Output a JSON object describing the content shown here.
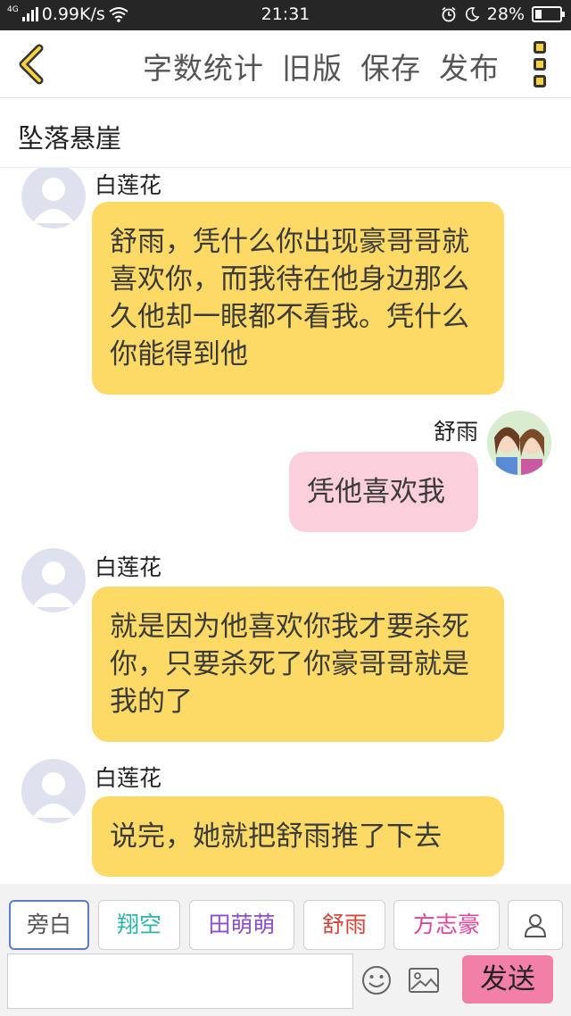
{
  "status_bar": {
    "network_tag": "4G",
    "speed": "0.99K/s",
    "time": "21:31",
    "battery_text": "28%",
    "battery_level": 0.28
  },
  "toolbar": {
    "word_count_label": "字数统计",
    "old_version_label": "旧版",
    "save_label": "保存",
    "publish_label": "发布"
  },
  "story": {
    "title": "坠落悬崖"
  },
  "messages": [
    {
      "speaker": "白莲花",
      "side": "left",
      "text": "舒雨，凭什么你出现豪哥哥就喜欢你，而我待在他身边那么久他却一眼都不看我。凭什么你能得到他"
    },
    {
      "speaker": "舒雨",
      "side": "right",
      "text": "凭他喜欢我"
    },
    {
      "speaker": "白莲花",
      "side": "left",
      "text": "就是因为他喜欢你我才要杀死你，只要杀死了你豪哥哥就是我的了"
    },
    {
      "speaker": "白莲花",
      "side": "left",
      "text": "说完，她就把舒雨推了下去"
    }
  ],
  "characters": [
    {
      "name": "旁白",
      "color": "#555555"
    },
    {
      "name": "翔空",
      "color": "#2bb5a6"
    },
    {
      "name": "田萌萌",
      "color": "#8a4fd0"
    },
    {
      "name": "舒雨",
      "color": "#d6453b"
    },
    {
      "name": "方志豪",
      "color": "#e0459a"
    }
  ],
  "input": {
    "placeholder": "",
    "send_label": "发送"
  }
}
